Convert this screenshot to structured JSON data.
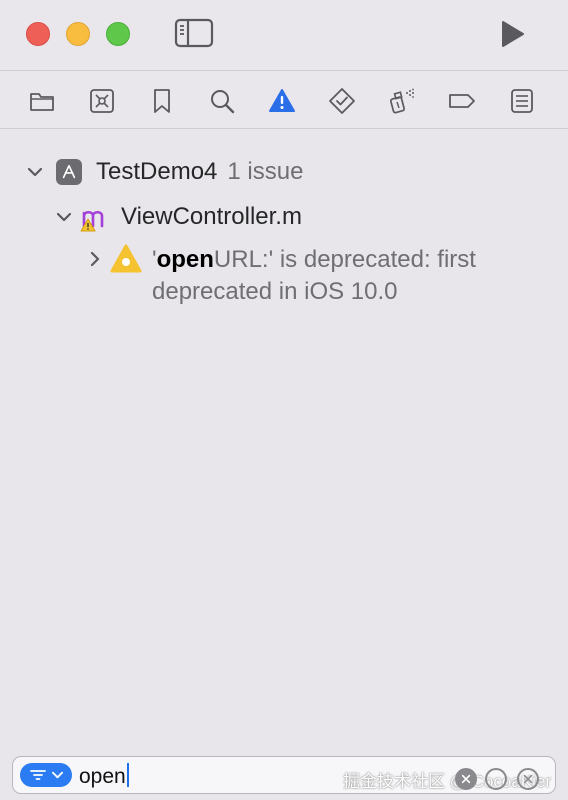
{
  "window": {
    "run_icon": "play-icon",
    "sidebar_icon": "sidebar-toggle-icon"
  },
  "navigator_tabs": [
    {
      "name": "project-navigator",
      "icon": "folder-icon"
    },
    {
      "name": "source-control",
      "icon": "source-control-icon"
    },
    {
      "name": "bookmarks",
      "icon": "bookmark-icon"
    },
    {
      "name": "find",
      "icon": "search-icon"
    },
    {
      "name": "issues",
      "icon": "warning-icon",
      "active": true
    },
    {
      "name": "tests",
      "icon": "test-diamond-icon"
    },
    {
      "name": "debug",
      "icon": "debug-spray-icon"
    },
    {
      "name": "breakpoints",
      "icon": "breakpoint-icon"
    },
    {
      "name": "reports",
      "icon": "report-icon"
    }
  ],
  "accent_color": "#2b6fe8",
  "tree": {
    "project": {
      "name": "TestDemo4",
      "issue_count": "1 issue"
    },
    "file": {
      "name": "ViewController.m"
    },
    "issue": {
      "quote_open": "'",
      "match": "open",
      "rest": "URL:' is deprecated: first deprecated in iOS 10.0"
    }
  },
  "filter": {
    "value": "open"
  },
  "watermark": "掘金技术社区 @ CocoaKier"
}
